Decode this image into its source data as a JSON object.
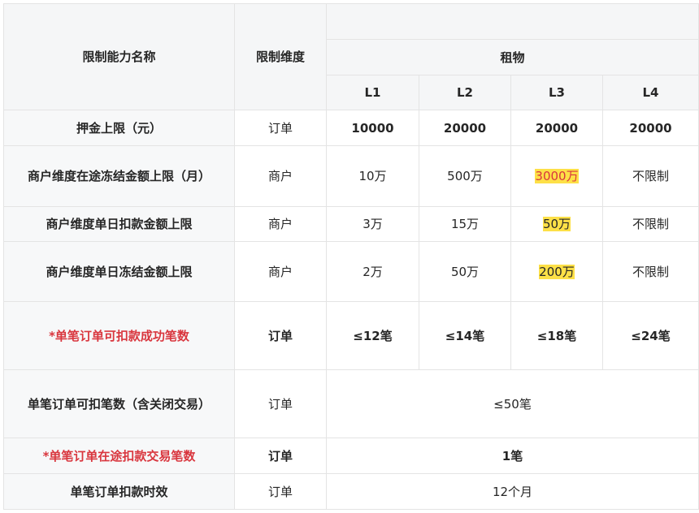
{
  "header": {
    "col_name": "限制能力名称",
    "col_dim": "限制维度",
    "group": "租物",
    "levels": [
      "L1",
      "L2",
      "L3",
      "L4"
    ]
  },
  "rows": [
    {
      "name": "押金上限（元）",
      "dim": "订单",
      "values": [
        "10000",
        "20000",
        "20000",
        "20000"
      ]
    },
    {
      "name": "商户维度在途冻结金额上限（月）",
      "dim": "商户",
      "values": [
        "10万",
        "500万",
        "3000万",
        "不限制"
      ]
    },
    {
      "name": "商户维度单日扣款金额上限",
      "dim": "商户",
      "values": [
        "3万",
        "15万",
        "50万",
        "不限制"
      ]
    },
    {
      "name": "商户维度单日冻结金额上限",
      "dim": "商户",
      "values": [
        "2万",
        "50万",
        "200万",
        "不限制"
      ]
    },
    {
      "name": "*单笔订单可扣款成功笔数",
      "dim": "订单",
      "values": [
        "≤12笔",
        "≤14笔",
        "≤18笔",
        "≤24笔"
      ]
    },
    {
      "name": "单笔订单可扣笔数（含关闭交易）",
      "dim": "订单",
      "merged": "≤50笔"
    },
    {
      "name": "*单笔订单在途扣款交易笔数",
      "dim": "订单",
      "merged": "1笔"
    },
    {
      "name": "单笔订单扣款时效",
      "dim": "订单",
      "merged": "12个月"
    }
  ],
  "colors": {
    "highlight": "#fde047",
    "warning_text": "#d9363e"
  }
}
